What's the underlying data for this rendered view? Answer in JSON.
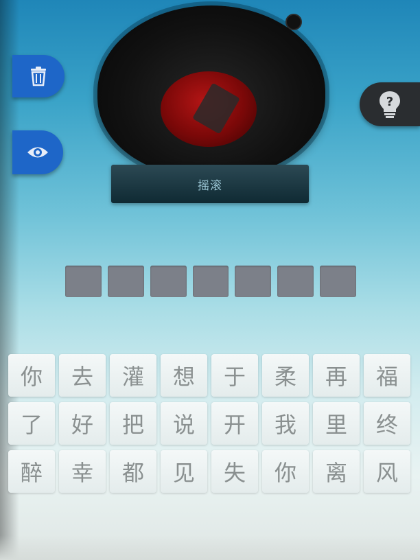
{
  "category_label": "摇滚",
  "buttons": {
    "delete_icon": "trash-icon",
    "reveal_icon": "eye-icon",
    "hint_icon": "lightbulb-question-icon"
  },
  "answer": {
    "slot_count": 7
  },
  "characters": [
    [
      "你",
      "去",
      "灌",
      "想",
      "于",
      "柔",
      "再",
      "福"
    ],
    [
      "了",
      "好",
      "把",
      "说",
      "开",
      "我",
      "里",
      "终"
    ],
    [
      "醉",
      "幸",
      "都",
      "见",
      "失",
      "你",
      "离",
      "风"
    ]
  ],
  "colors": {
    "side_button": "#1e66c8",
    "hint_button": "#2a2d30",
    "slot": "#7c8089",
    "record_label": "#b31515"
  }
}
